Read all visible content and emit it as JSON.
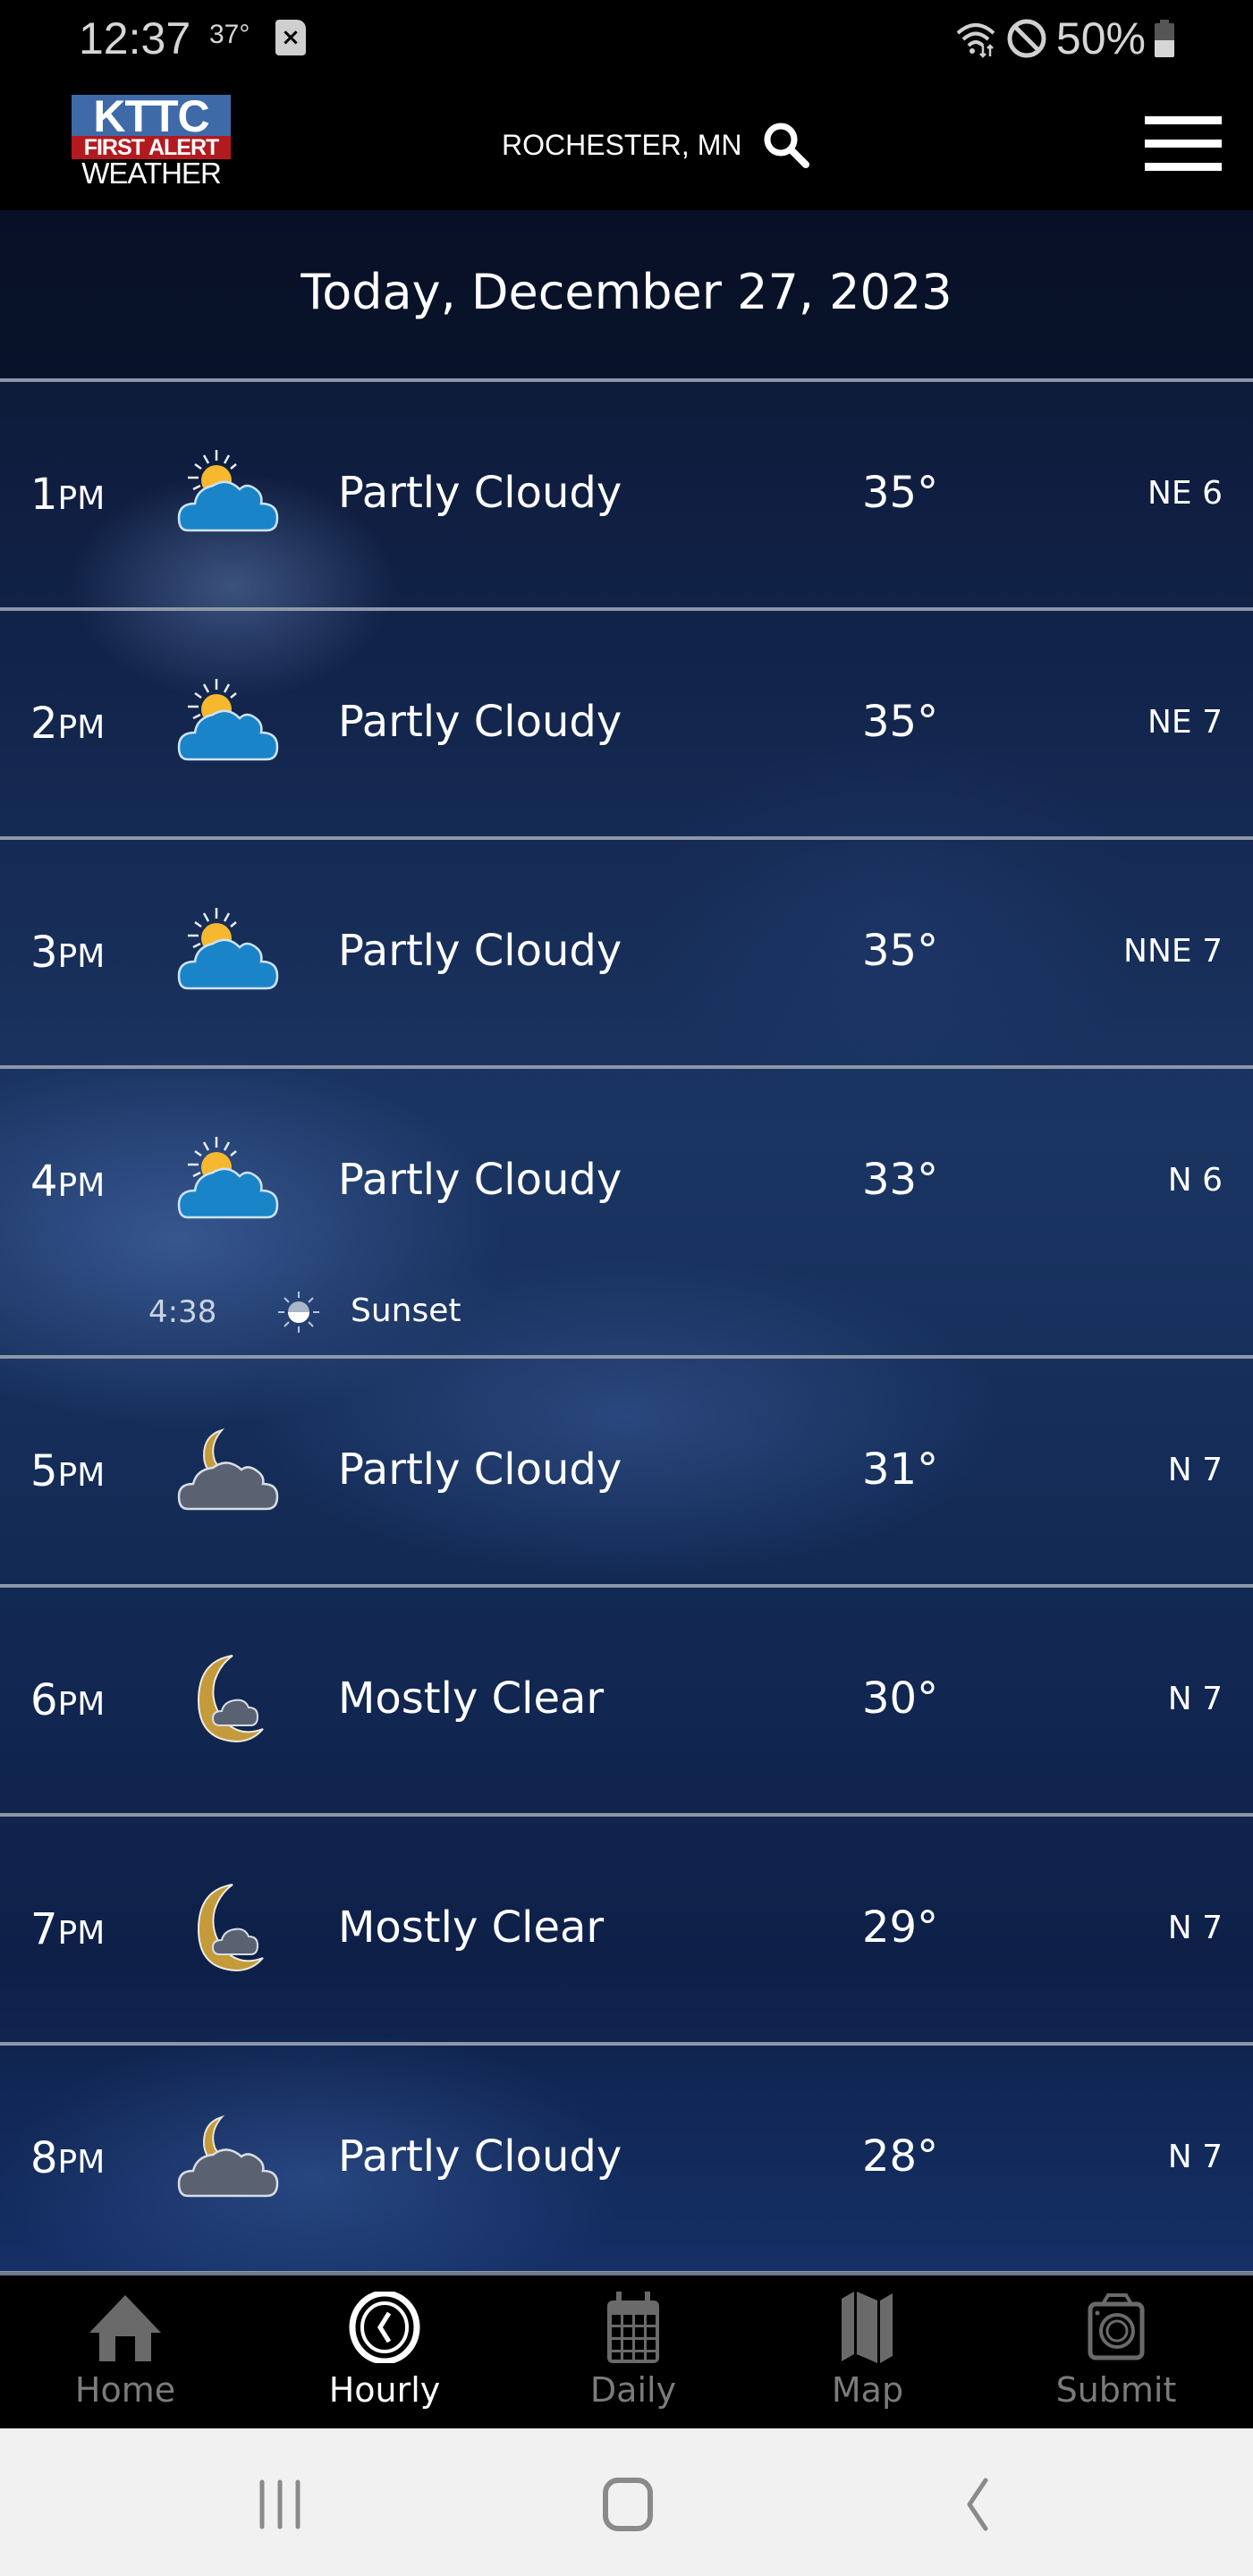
{
  "status_bar": {
    "time": "12:37",
    "temperature": "37°",
    "battery_percent": "50%",
    "battery_level": 0.5,
    "icons": [
      "sim-blocked-icon",
      "wifi-icon",
      "do-not-disturb-icon",
      "battery-icon"
    ]
  },
  "header": {
    "logo": {
      "line1": "KTTC",
      "line2": "FIRST ALERT",
      "line3": "WEATHER"
    },
    "location": "ROCHESTER, MN",
    "search_icon": "search-icon",
    "menu_icon": "hamburger-menu-icon"
  },
  "forecast": {
    "date_heading": "Today, December 27, 2023",
    "hours": [
      {
        "hour": "1",
        "period": "PM",
        "icon": "partly-cloudy-day",
        "condition": "Partly Cloudy",
        "temp": "35°",
        "wind": "NE 6"
      },
      {
        "hour": "2",
        "period": "PM",
        "icon": "partly-cloudy-day",
        "condition": "Partly Cloudy",
        "temp": "35°",
        "wind": "NE 7"
      },
      {
        "hour": "3",
        "period": "PM",
        "icon": "partly-cloudy-day",
        "condition": "Partly Cloudy",
        "temp": "35°",
        "wind": "NNE 7"
      },
      {
        "hour": "4",
        "period": "PM",
        "icon": "partly-cloudy-day",
        "condition": "Partly Cloudy",
        "temp": "33°",
        "wind": "N 6"
      },
      {
        "hour": "5",
        "period": "PM",
        "icon": "partly-cloudy-night",
        "condition": "Partly Cloudy",
        "temp": "31°",
        "wind": "N 7"
      },
      {
        "hour": "6",
        "period": "PM",
        "icon": "mostly-clear-night",
        "condition": "Mostly Clear",
        "temp": "30°",
        "wind": "N 7"
      },
      {
        "hour": "7",
        "period": "PM",
        "icon": "mostly-clear-night",
        "condition": "Mostly Clear",
        "temp": "29°",
        "wind": "N 7"
      },
      {
        "hour": "8",
        "period": "PM",
        "icon": "partly-cloudy-night",
        "condition": "Partly Cloudy",
        "temp": "28°",
        "wind": "N 7"
      }
    ],
    "sun_event": {
      "after_hour_index": 3,
      "time": "4:38",
      "label": "Sunset",
      "icon": "sunset-icon"
    }
  },
  "tab_bar": {
    "active": "Hourly",
    "tabs": [
      {
        "label": "Home",
        "icon": "home-icon"
      },
      {
        "label": "Hourly",
        "icon": "clock-icon"
      },
      {
        "label": "Daily",
        "icon": "calendar-icon"
      },
      {
        "label": "Map",
        "icon": "map-icon"
      },
      {
        "label": "Submit",
        "icon": "camera-icon"
      }
    ]
  },
  "system_nav": {
    "buttons": [
      "recent-apps",
      "home",
      "back"
    ]
  },
  "colors": {
    "logo_blue": "#3e6aa8",
    "logo_red": "#b31a1f",
    "cloud_blue": "#1a84c9",
    "sun_yellow": "#f5b82e",
    "moon_gold": "#c49a3a",
    "night_cloud": "#5a6272",
    "tab_inactive": "#7b7b7b",
    "tab_active": "#ffffff"
  }
}
